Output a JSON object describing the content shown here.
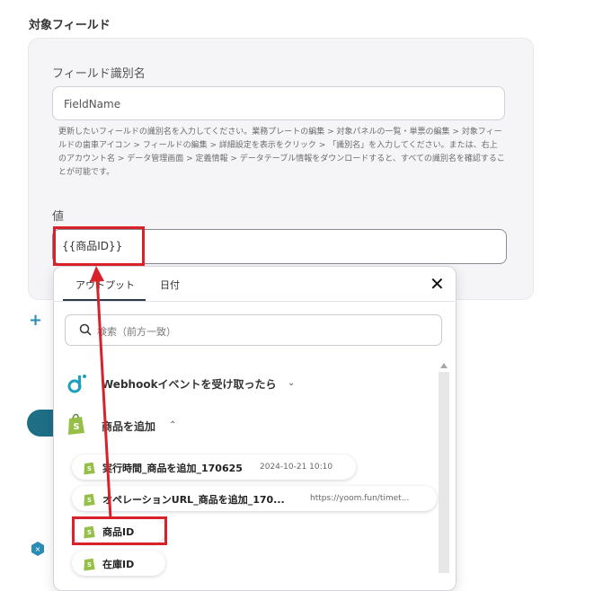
{
  "section": {
    "title": "対象フィールド"
  },
  "field_id": {
    "label": "フィールド識別名",
    "value": "FieldName",
    "help": "更新したいフィールドの識別名を入力してください。業務プレートの編集 > 対象パネルの一覧・単票の編集 > 対象フィールドの歯車アイコン > フィールドの編集 > 詳細設定を表示をクリック > 「識別名」を入力してください。または、右上のアカウント名 > データ管理画面 > 定義情報 > データテーブル情報をダウンロードすると、すべての識別名を確認することが可能です。"
  },
  "value_field": {
    "label": "値",
    "value": "{{商品ID}}"
  },
  "dropdown": {
    "tabs": [
      "アウトプット",
      "日付"
    ],
    "active_tab": "アウトプット",
    "search_placeholder": "検索（前方一致）",
    "groups": [
      {
        "label": "Webhookイベントを受け取ったら",
        "icon": "webhook-icon",
        "expanded": false
      },
      {
        "label": "商品を追加",
        "icon": "shopify-icon",
        "expanded": true
      }
    ],
    "items": [
      {
        "label": "実行時間_商品を追加_170625",
        "sub": "2024-10-21 10:10"
      },
      {
        "label": "オペレーションURL_商品を追加_170...",
        "sub": "https://yoom.fun/timet..."
      },
      {
        "label": "商品ID",
        "sub": ""
      },
      {
        "label": "在庫ID",
        "sub": ""
      }
    ]
  },
  "colors": {
    "accent": "#2a8bb3",
    "highlight": "#d9212b",
    "shopify": "#95bf47",
    "teal": "#1e6f86"
  }
}
